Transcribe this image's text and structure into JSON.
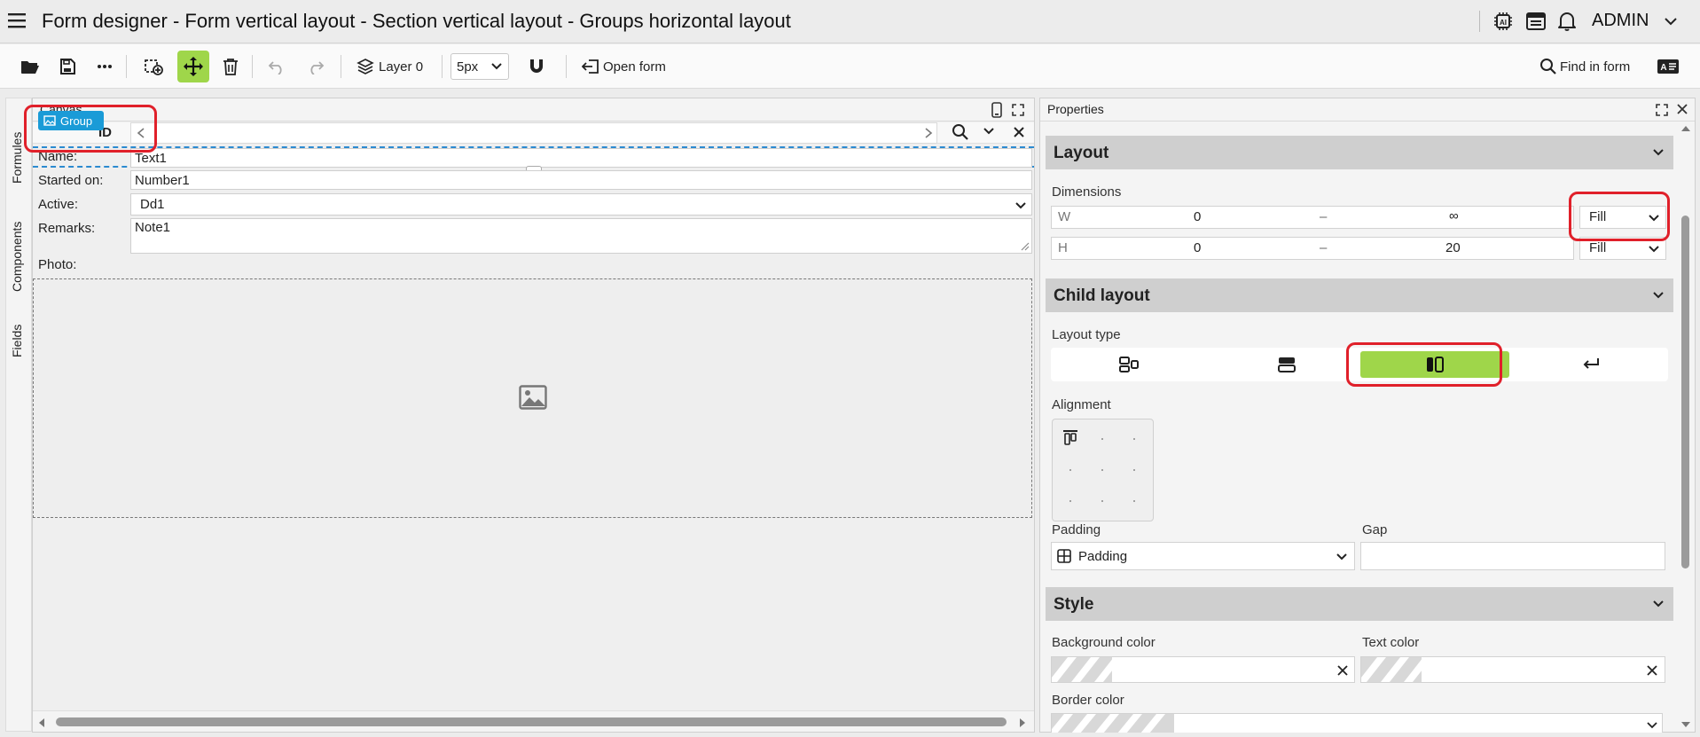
{
  "app": {
    "title": "Form designer - Form vertical layout - Section vertical layout - Groups horizontal layout",
    "user": "ADMIN"
  },
  "toolbar": {
    "layer_label": "Layer 0",
    "grid_value": "5px",
    "open_form_label": "Open form",
    "find_label": "Find in form"
  },
  "side_tabs": [
    "Formules",
    "Components",
    "Fields"
  ],
  "canvas": {
    "title": "Canvas",
    "group_badge": "Group",
    "header_row_label": "ID",
    "fields": [
      {
        "label": "Name:",
        "value": "Text1"
      },
      {
        "label": "Started on:",
        "value": "Number1"
      },
      {
        "label": "Active:",
        "value": "Dd1"
      },
      {
        "label": "Remarks:",
        "value": "Note1"
      },
      {
        "label": "Photo:",
        "value": ""
      }
    ]
  },
  "properties": {
    "title": "Properties",
    "layout": {
      "title": "Layout",
      "dimensions_label": "Dimensions",
      "w_label": "W",
      "w_min": "0",
      "w_sep": "–",
      "w_max": "∞",
      "w_mode": "Fill",
      "h_label": "H",
      "h_min": "0",
      "h_sep": "–",
      "h_max": "20",
      "h_mode": "Fill"
    },
    "child_layout": {
      "title": "Child layout",
      "layout_type_label": "Layout type",
      "selected_index": 2,
      "alignment_label": "Alignment",
      "padding_label": "Padding",
      "padding_value": "Padding",
      "gap_label": "Gap",
      "gap_value": ""
    },
    "style": {
      "title": "Style",
      "bg_color_label": "Background color",
      "text_color_label": "Text color",
      "border_color_label": "Border color"
    }
  },
  "colors": {
    "accent_green": "#9fd64a",
    "badge_blue": "#1a9bd7",
    "highlight_red": "#e0202a"
  }
}
